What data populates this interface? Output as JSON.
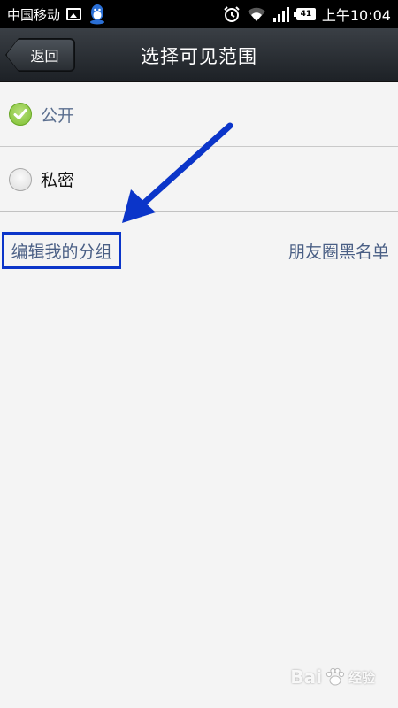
{
  "status_bar": {
    "carrier": "中国移动",
    "battery": "41",
    "time": "上午10:04",
    "icons": [
      "image-icon",
      "qq-icon",
      "alarm-icon",
      "wifi-icon",
      "signal-icon",
      "battery-icon"
    ]
  },
  "nav": {
    "back_label": "返回",
    "title": "选择可见范围"
  },
  "options": [
    {
      "label": "公开",
      "selected": true
    },
    {
      "label": "私密",
      "selected": false
    }
  ],
  "links": {
    "edit_groups": "编辑我的分组",
    "blacklist": "朋友圈黑名单"
  },
  "watermark": {
    "brand": "Bai",
    "sub": "经验"
  },
  "colors": {
    "annotation_blue": "#0b35c9",
    "link_text": "#4a5f85",
    "check_green": "#7cbf2f"
  }
}
